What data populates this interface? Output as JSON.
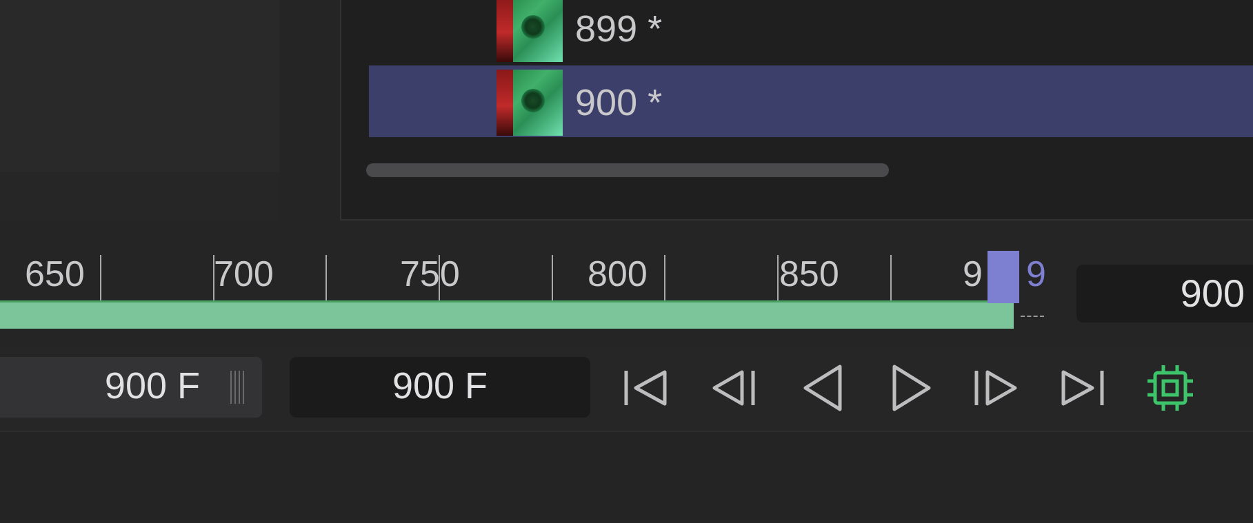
{
  "frames": [
    {
      "label": "899 *"
    },
    {
      "label": "900 *"
    }
  ],
  "ruler": {
    "ticks": [
      "650",
      "700",
      "750",
      "800",
      "850",
      "9",
      "9"
    ],
    "progress_color": "#7cc49a",
    "playhead_color": "#7d7fd0"
  },
  "current_frame": "900",
  "start_frame": "900 F",
  "end_frame": "900 F",
  "transport": {
    "accent_color": "#3ec46a",
    "buttons": [
      "skip-to-start-icon",
      "step-back-icon",
      "play-reverse-icon",
      "play-forward-icon",
      "step-forward-icon",
      "skip-to-end-icon",
      "chip-icon"
    ]
  }
}
